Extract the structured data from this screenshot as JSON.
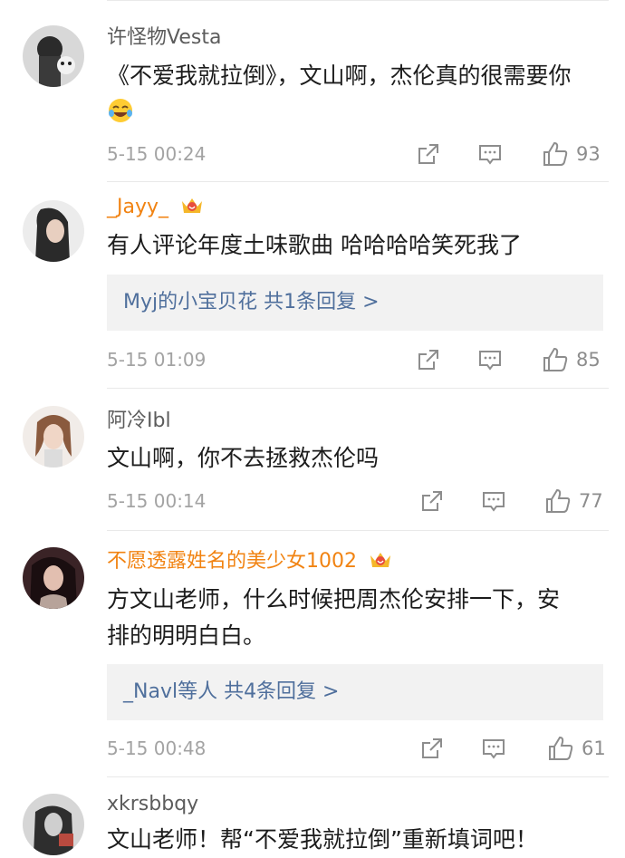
{
  "comments": [
    {
      "username": "许怪物Vesta",
      "text": "《不爱我就拉倒》，文山啊，杰伦真的很需要你",
      "emoji": "laughing-tears",
      "time": "5-15 00:24",
      "likes": "93",
      "vip": false
    },
    {
      "username": "_Jayy_",
      "text": "有人评论年度土味歌曲 哈哈哈哈笑死我了",
      "reply_summary": "Myj的小宝贝花  共1条回复 >",
      "time": "5-15 01:09",
      "likes": "85",
      "vip": true
    },
    {
      "username": "阿冷Ibl",
      "text": "文山啊，你不去拯救杰伦吗",
      "time": "5-15 00:14",
      "likes": "77",
      "vip": false
    },
    {
      "username": "不愿透露姓名的美少女1002",
      "text": "方文山老师，什么时候把周杰伦安排一下，安排的明明白白。",
      "reply_summary": "_Navl等人  共4条回复 >",
      "time": "5-15 00:48",
      "likes": "61",
      "vip": true
    },
    {
      "username": "xkrsbbqy",
      "text": "文山老师！帮“不爱我就拉倒”重新填词吧！",
      "vip": false
    }
  ],
  "colors": {
    "vip_name": "#f18312",
    "reply_link": "#4f6f9c",
    "meta_gray": "#a3a3a3"
  },
  "icons": [
    "share-icon",
    "comment-icon",
    "like-icon",
    "crown-icon"
  ]
}
